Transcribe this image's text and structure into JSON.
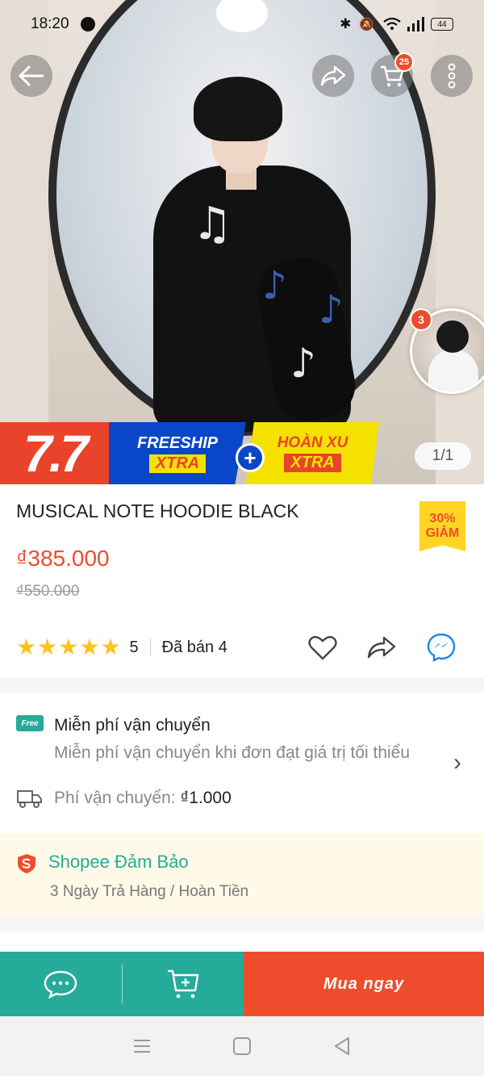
{
  "status_bar": {
    "time": "18:20",
    "battery": "44"
  },
  "header": {
    "cart_count": "25"
  },
  "gallery": {
    "pager": "1/1",
    "thumb_count": "3"
  },
  "promo": {
    "sale": "7.7",
    "freeship": "FREESHIP",
    "xtra1": "XTRA",
    "plus": "+",
    "hoanxu": "HOÀN XU",
    "xtra2": "XTRA"
  },
  "product": {
    "title": "MUSICAL NOTE HOODIE BLACK",
    "discount_pct": "30%",
    "discount_label": "GIẢM",
    "price": "₫385.000",
    "old_price": "₫550.000",
    "rating": "5",
    "rating_stars": 5,
    "sold": "Đã bán 4"
  },
  "shipping": {
    "free_badge": "Free",
    "title": "Miễn phí vận chuyển",
    "subtitle": "Miễn phí vận chuyển khi đơn đạt giá trị tối thiểu",
    "fee_label": "Phí vận chuyển:",
    "fee_value": "₫1.000"
  },
  "guarantee": {
    "title": "Shopee Đảm Bảo",
    "subtitle": "3 Ngày Trả Hàng / Hoàn Tiền"
  },
  "actions": {
    "buy_now": "Mua ngay"
  },
  "colors": {
    "brand": "#ee4d2d",
    "teal": "#26aa99",
    "star": "#ffc21a"
  }
}
